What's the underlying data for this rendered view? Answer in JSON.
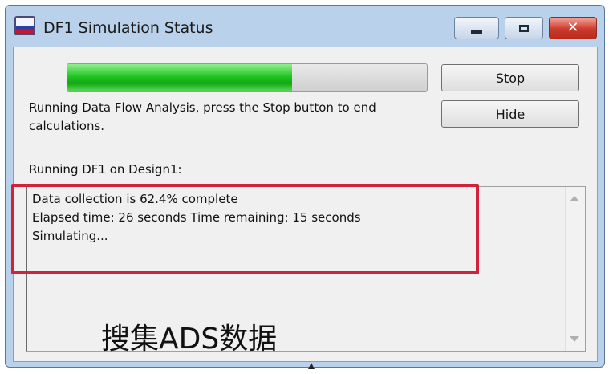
{
  "window": {
    "title": "DF1 Simulation Status",
    "controls": {
      "minimize_icon": "minimize-icon",
      "maximize_icon": "maximize-icon",
      "close_icon": "close-icon",
      "close_glyph": "✕"
    }
  },
  "progress": {
    "percent": 62.4,
    "color": "#22c422"
  },
  "message": "Running Data Flow Analysis, press the Stop button to end calculations.",
  "buttons": {
    "stop": "Stop",
    "hide": "Hide"
  },
  "running_label": "Running DF1 on Design1:",
  "log": {
    "lines": [
      "Data collection is 62.4% complete",
      "Elapsed time: 26 seconds Time remaining: 15 seconds",
      "Simulating..."
    ]
  },
  "annotation": {
    "caption": "搜集ADS数据",
    "highlight_color": "#d4213b"
  }
}
